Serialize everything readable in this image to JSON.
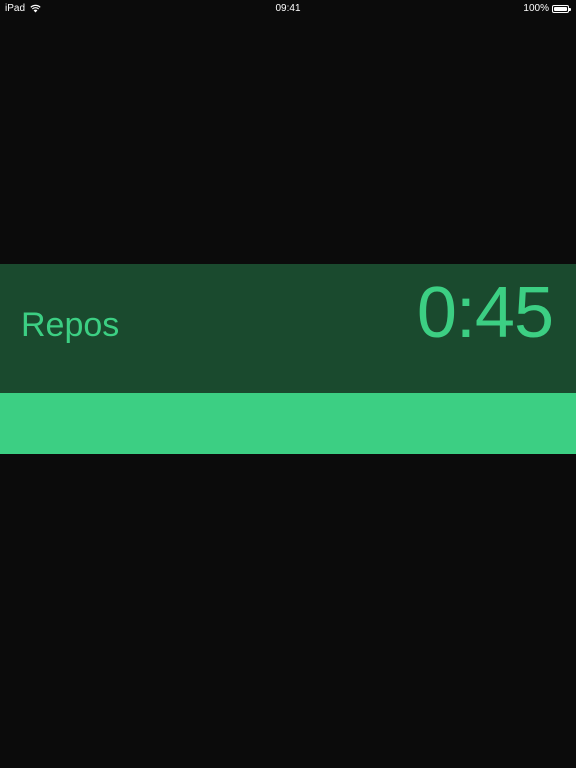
{
  "status_bar": {
    "device": "iPad",
    "time": "09:41",
    "battery": "100%",
    "battery_level": 1.0,
    "wifi_icon": "wifi-icon",
    "battery_icon": "battery-icon"
  },
  "timer": {
    "phase": "Repos",
    "time": "0:45",
    "progress": 1.0
  },
  "colors": {
    "background": "#0b0b0b",
    "panel": "#1a4a2e",
    "accent": "#3ccf83"
  }
}
